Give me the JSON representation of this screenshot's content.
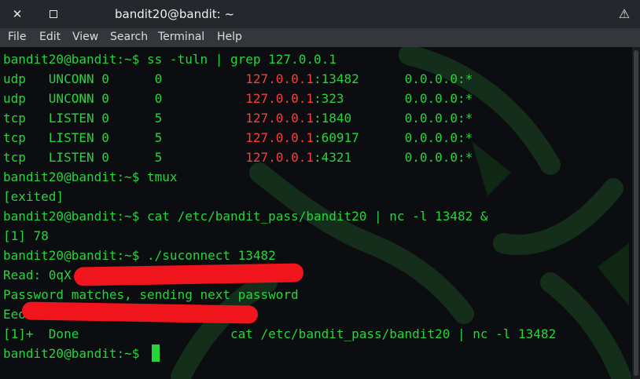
{
  "window": {
    "title": "bandit20@bandit: ~",
    "close_glyph": "✕",
    "right_glyph": "⚠",
    "icons": [
      "close-icon",
      "maximize-icon",
      "warning-icon"
    ]
  },
  "menu": {
    "items": [
      "File",
      "Edit",
      "View",
      "Search",
      "Terminal",
      "Help"
    ]
  },
  "terminal": {
    "prompt": "bandit20@bandit:~$ ",
    "commands": {
      "ss": "ss -tuln | grep 127.0.0.1",
      "tmux": "tmux",
      "cat": "cat /etc/bandit_pass/bandit20 | nc -l 13482 &",
      "suconnect": "./suconnect 13482"
    },
    "ss_rows": [
      {
        "proto": "udp   ",
        "state": "UNCONN ",
        "recvq": "0      ",
        "sendq": "0           ",
        "ip": "127.0.0.1",
        "port": ":13482",
        "peer": "      0.0.0.0:*"
      },
      {
        "proto": "udp   ",
        "state": "UNCONN ",
        "recvq": "0      ",
        "sendq": "0           ",
        "ip": "127.0.0.1",
        "port": ":323",
        "peer": "        0.0.0.0:*"
      },
      {
        "proto": "tcp   ",
        "state": "LISTEN ",
        "recvq": "0      ",
        "sendq": "5           ",
        "ip": "127.0.0.1",
        "port": ":1840",
        "peer": "       0.0.0.0:*"
      },
      {
        "proto": "tcp   ",
        "state": "LISTEN ",
        "recvq": "0      ",
        "sendq": "5           ",
        "ip": "127.0.0.1",
        "port": ":60917",
        "peer": "      0.0.0.0:*"
      },
      {
        "proto": "tcp   ",
        "state": "LISTEN ",
        "recvq": "0      ",
        "sendq": "5           ",
        "ip": "127.0.0.1",
        "port": ":4321",
        "peer": "       0.0.0.0:*"
      }
    ],
    "exited": "[exited]",
    "job_started": "[1] 78",
    "read_line": "Read: 0qX",
    "password_match": "Password matches, sending next password",
    "next_pass_prefix": "Eeol",
    "job_done": "[1]+  Done                    cat /etc/bandit_pass/bandit20 | nc -l 13482",
    "colors": {
      "text": "#23d63a",
      "ip": "#ff3b3b",
      "redaction": "#f0141c",
      "background": "#0b0d10"
    }
  }
}
